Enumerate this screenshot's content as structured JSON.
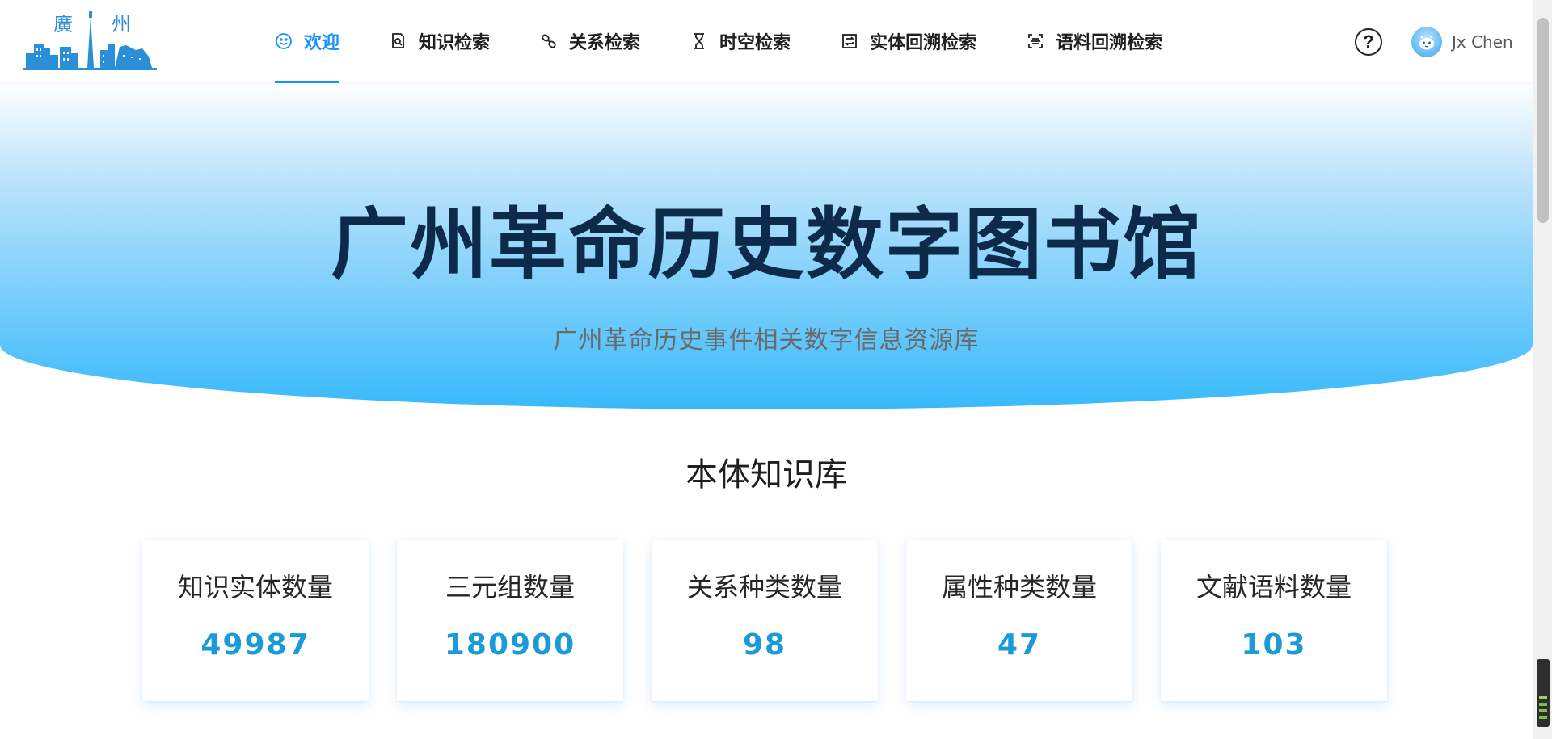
{
  "header": {
    "logo": {
      "text_left": "廣",
      "text_right": "州"
    },
    "nav": [
      {
        "label": "欢迎",
        "icon": "smile-icon",
        "active": true
      },
      {
        "label": "知识检索",
        "icon": "file-search-icon",
        "active": false
      },
      {
        "label": "关系检索",
        "icon": "link-icon",
        "active": false
      },
      {
        "label": "时空检索",
        "icon": "hourglass-icon",
        "active": false
      },
      {
        "label": "实体回溯检索",
        "icon": "retweet-icon",
        "active": false
      },
      {
        "label": "语料回溯检索",
        "icon": "scan-icon",
        "active": false
      }
    ],
    "help_icon": "question-circle-icon",
    "user": {
      "name": "Jx Chen",
      "avatar_icon": "avatar-icon"
    }
  },
  "hero": {
    "title": "广州革命历史数字图书馆",
    "subtitle": "广州革命历史事件相关数字信息资源库"
  },
  "stats": {
    "section_title": "本体知识库",
    "cards": [
      {
        "label": "知识实体数量",
        "value": "49987"
      },
      {
        "label": "三元组数量",
        "value": "180900"
      },
      {
        "label": "关系种类数量",
        "value": "98"
      },
      {
        "label": "属性种类数量",
        "value": "47"
      },
      {
        "label": "文献语料数量",
        "value": "103"
      }
    ]
  },
  "colors": {
    "accent": "#1890ff",
    "stat_value": "#1a9ad6",
    "hero_title": "#0d2a4a",
    "hero_gradient_bottom": "#38b9fb"
  }
}
